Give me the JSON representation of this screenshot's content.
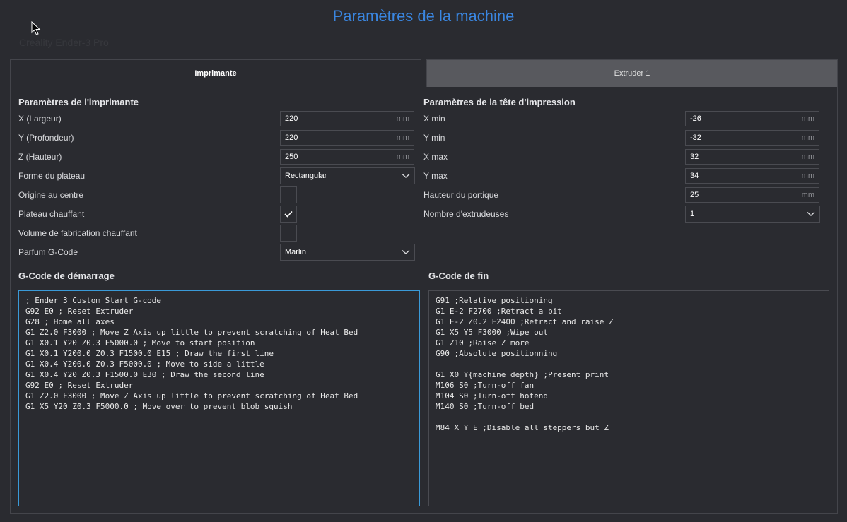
{
  "dialog": {
    "title": "Paramètres de la machine",
    "ghost_label": "Creality Ender-3 Pro"
  },
  "tabs": [
    {
      "label": "Imprimante",
      "active": true
    },
    {
      "label": "Extruder 1",
      "active": false
    }
  ],
  "printer": {
    "section_title": "Paramètres de l'imprimante",
    "x": {
      "label": "X (Largeur)",
      "value": "220",
      "unit": "mm"
    },
    "y": {
      "label": "Y (Profondeur)",
      "value": "220",
      "unit": "mm"
    },
    "z": {
      "label": "Z (Hauteur)",
      "value": "250",
      "unit": "mm"
    },
    "bed_shape": {
      "label": "Forme du plateau",
      "value": "Rectangular"
    },
    "origin_center": {
      "label": "Origine au centre",
      "checked": false
    },
    "heated_bed": {
      "label": "Plateau chauffant",
      "checked": true
    },
    "heated_volume": {
      "label": "Volume de fabrication chauffant",
      "checked": false
    },
    "gcode_flavor": {
      "label": "Parfum G-Code",
      "value": "Marlin"
    }
  },
  "printhead": {
    "section_title": "Paramètres de la tête d'impression",
    "xmin": {
      "label": "X min",
      "value": "-26",
      "unit": "mm"
    },
    "ymin": {
      "label": "Y min",
      "value": "-32",
      "unit": "mm"
    },
    "xmax": {
      "label": "X max",
      "value": "32",
      "unit": "mm"
    },
    "ymax": {
      "label": "Y max",
      "value": "34",
      "unit": "mm"
    },
    "gantry": {
      "label": "Hauteur du portique",
      "value": "25",
      "unit": "mm"
    },
    "extruder_count": {
      "label": "Nombre d'extrudeuses",
      "value": "1"
    }
  },
  "start_gcode": {
    "title": "G-Code de démarrage",
    "text": "; Ender 3 Custom Start G-code\nG92 E0 ; Reset Extruder\nG28 ; Home all axes\nG1 Z2.0 F3000 ; Move Z Axis up little to prevent scratching of Heat Bed\nG1 X0.1 Y20 Z0.3 F5000.0 ; Move to start position\nG1 X0.1 Y200.0 Z0.3 F1500.0 E15 ; Draw the first line\nG1 X0.4 Y200.0 Z0.3 F5000.0 ; Move to side a little\nG1 X0.4 Y20 Z0.3 F1500.0 E30 ; Draw the second line\nG92 E0 ; Reset Extruder\nG1 Z2.0 F3000 ; Move Z Axis up little to prevent scratching of Heat Bed\nG1 X5 Y20 Z0.3 F5000.0 ; Move over to prevent blob squish"
  },
  "end_gcode": {
    "title": "G-Code de fin",
    "text": "G91 ;Relative positioning\nG1 E-2 F2700 ;Retract a bit\nG1 E-2 Z0.2 F2400 ;Retract and raise Z\nG1 X5 Y5 F3000 ;Wipe out\nG1 Z10 ;Raise Z more\nG90 ;Absolute positionning\n\nG1 X0 Y{machine_depth} ;Present print\nM106 S0 ;Turn-off fan\nM104 S0 ;Turn-off hotend\nM140 S0 ;Turn-off bed\n\nM84 X Y E ;Disable all steppers but Z"
  },
  "icons": {
    "dropdown": "chevron-down-icon",
    "check": "check-icon",
    "cursor": "mouse-cursor-icon"
  },
  "colors": {
    "accent": "#3a86e0",
    "background": "#2a2b30",
    "inactive_tab": "#58595e",
    "focus_border": "#3a9ad8"
  }
}
